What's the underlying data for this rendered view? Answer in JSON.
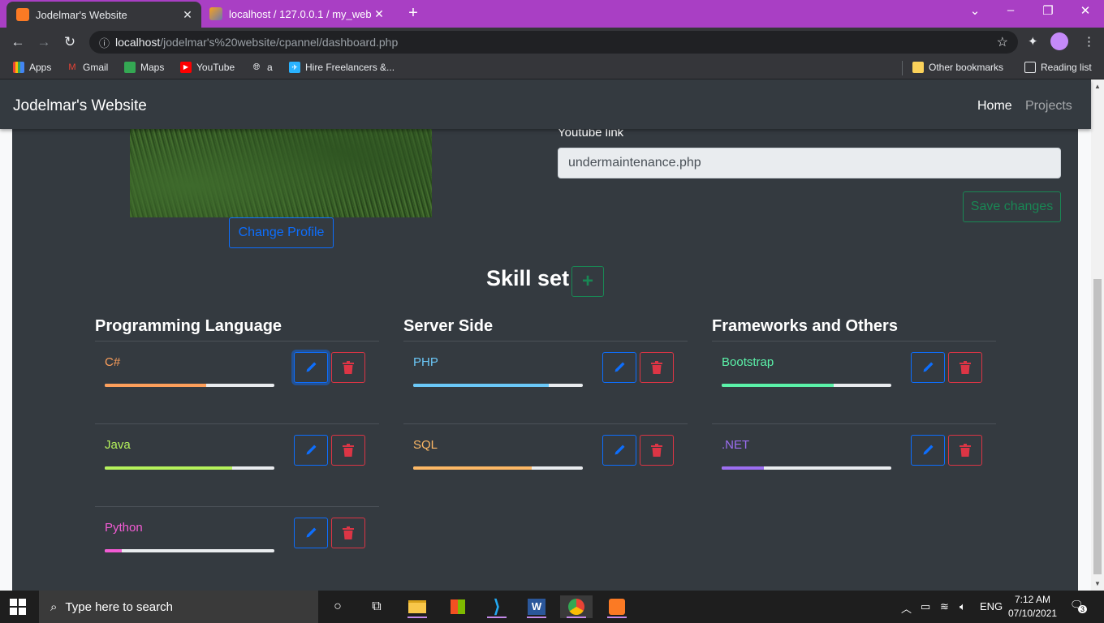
{
  "browser": {
    "tabs": [
      {
        "title": "Jodelmar's Website",
        "favicon": "xampp-icon",
        "active": true
      },
      {
        "title": "localhost / 127.0.0.1 / my_website",
        "favicon": "phpmyadmin-icon",
        "active": false
      }
    ],
    "url_host": "localhost",
    "url_path": "/jodelmar's%20website/cpannel/dashboard.php",
    "bookmarks": [
      "Apps",
      "Gmail",
      "Maps",
      "YouTube",
      "a",
      "Hire Freelancers &...",
      "Other bookmarks",
      "Reading list"
    ]
  },
  "site": {
    "brand": "Jodelmar's Website",
    "nav": {
      "home": "Home",
      "projects": "Projects"
    },
    "change_profile": "Change Profile",
    "youtube_label": "Youtube link",
    "youtube_value": "undermaintenance.php",
    "save_changes": "Save changes",
    "skill_title": "Skill set",
    "add_skill": "+"
  },
  "skills": {
    "columns": [
      {
        "heading": "Programming Language",
        "items": [
          {
            "name": "C#",
            "color": "#fd9f5b",
            "level": 0.6
          },
          {
            "name": "Java",
            "color": "#b5f25b",
            "level": 0.75
          },
          {
            "name": "Python",
            "color": "#f35bd4",
            "level": 0.1
          }
        ]
      },
      {
        "heading": "Server Side",
        "items": [
          {
            "name": "PHP",
            "color": "#6bc8f8",
            "level": 0.8
          },
          {
            "name": "SQL",
            "color": "#fdb865",
            "level": 0.7
          }
        ]
      },
      {
        "heading": "Frameworks and Others",
        "items": [
          {
            "name": "Bootstrap",
            "color": "#5bf2a9",
            "level": 0.66
          },
          {
            "name": ".NET",
            "color": "#9d6ef2",
            "level": 0.25
          }
        ]
      }
    ]
  },
  "taskbar": {
    "search_placeholder": "Type here to search",
    "lang": "ENG",
    "time": "7:12 AM",
    "date": "07/10/2021",
    "notifications": "3"
  }
}
